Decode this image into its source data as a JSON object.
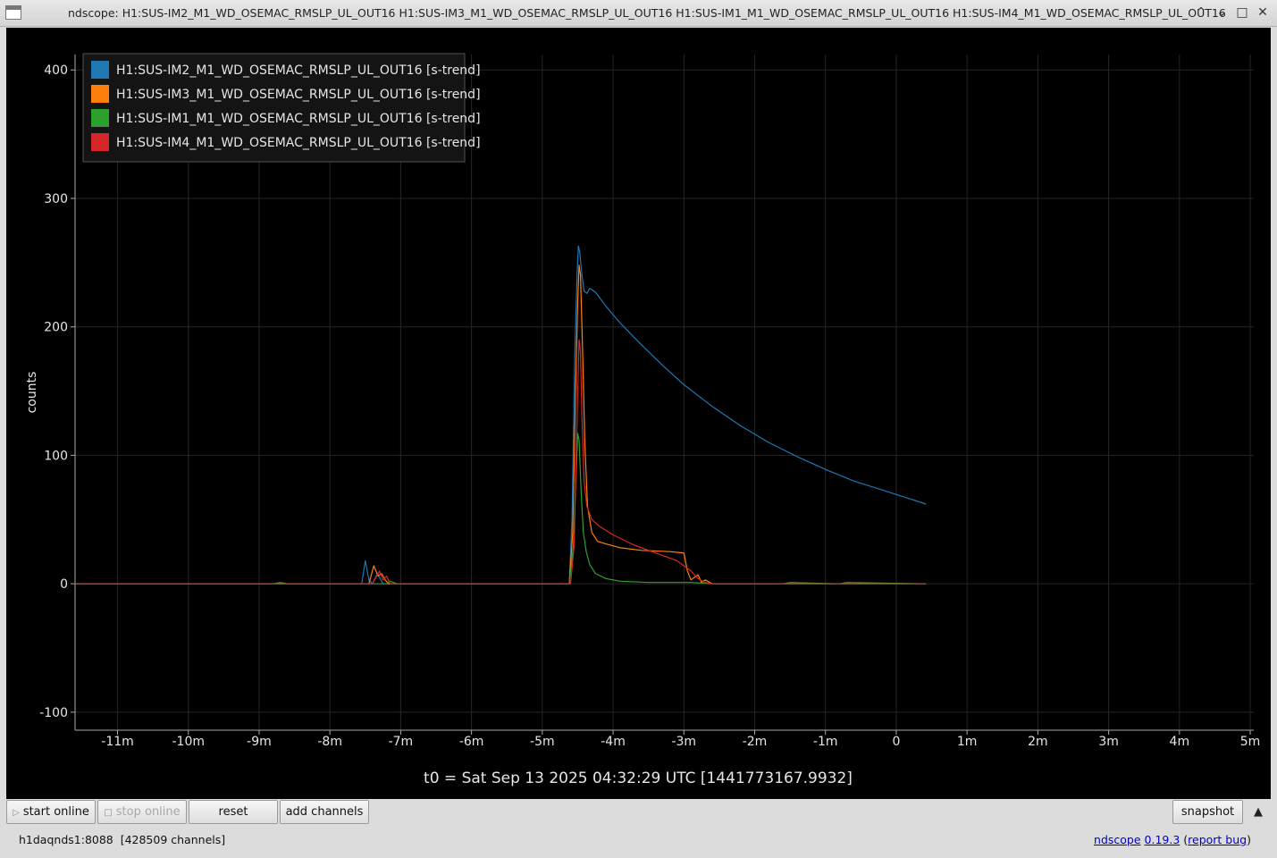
{
  "window": {
    "title": "ndscope: H1:SUS-IM2_M1_WD_OSEMAC_RMSLP_UL_OUT16 H1:SUS-IM3_M1_WD_OSEMAC_RMSLP_UL_OUT16 H1:SUS-IM1_M1_WD_OSEMAC_RMSLP_UL_OUT16 H1:SUS-IM4_M1_WD_OSEMAC_RMSLP_UL_OUT16",
    "minimize_icon": "chevron-up-icon",
    "maximize_icon": "chevron-down-icon",
    "restore_icon": "square-icon",
    "close_icon": "close-icon"
  },
  "chart_data": {
    "type": "line",
    "ylabel": "counts",
    "xlabel": "t0 = Sat Sep 13 2025 04:32:29 UTC [1441773167.9932]",
    "x_units": "minutes",
    "xlim": [
      -11.6,
      5.05
    ],
    "ylim": [
      -114,
      412
    ],
    "x_ticks": [
      -11,
      -10,
      -9,
      -8,
      -7,
      -6,
      -5,
      -4,
      -3,
      -2,
      -1,
      0,
      1,
      2,
      3,
      4,
      5
    ],
    "x_tick_labels": [
      "-11m",
      "-10m",
      "-9m",
      "-8m",
      "-7m",
      "-6m",
      "-5m",
      "-4m",
      "-3m",
      "-2m",
      "-1m",
      "0",
      "1m",
      "2m",
      "3m",
      "4m",
      "5m"
    ],
    "y_ticks": [
      -100,
      0,
      100,
      200,
      300,
      400
    ],
    "y_tick_labels": [
      "-100",
      "0",
      "100",
      "200",
      "300",
      "400"
    ],
    "grid": true,
    "legend_position": "top-left",
    "series": [
      {
        "name": "H1:SUS-IM2_M1_WD_OSEMAC_RMSLP_UL_OUT16 [s-trend]",
        "color": "#1f77b4",
        "x": [
          -11.6,
          -7.55,
          -7.5,
          -7.45,
          -7.4,
          -7.33,
          -7.25,
          -7.2,
          -7.0,
          -4.62,
          -4.58,
          -4.54,
          -4.51,
          -4.49,
          -4.47,
          -4.44,
          -4.41,
          -4.37,
          -4.33,
          -4.25,
          -4.1,
          -3.9,
          -3.6,
          -3.3,
          -3.0,
          -2.6,
          -2.2,
          -1.8,
          -1.4,
          -1.0,
          -0.6,
          -0.2,
          0.2,
          0.42
        ],
        "y": [
          0,
          0,
          18,
          3,
          0,
          8,
          0,
          0,
          0,
          0,
          50,
          180,
          240,
          263,
          258,
          240,
          228,
          226,
          230,
          227,
          216,
          203,
          186,
          170,
          155,
          138,
          123,
          110,
          99,
          89,
          80,
          73,
          66,
          62
        ]
      },
      {
        "name": "H1:SUS-IM3_M1_WD_OSEMAC_RMSLP_UL_OUT16 [s-trend]",
        "color": "#ff7f0e",
        "x": [
          -11.6,
          -7.45,
          -7.38,
          -7.32,
          -7.27,
          -7.22,
          -7.17,
          -7.1,
          -4.62,
          -4.57,
          -4.53,
          -4.5,
          -4.48,
          -4.46,
          -4.43,
          -4.4,
          -4.36,
          -4.3,
          -4.22,
          -4.1,
          -3.9,
          -3.6,
          -3.2,
          -3.0,
          -2.95,
          -2.9,
          -2.8,
          -2.75,
          -2.7,
          -2.6,
          0.42
        ],
        "y": [
          0,
          0,
          14,
          6,
          8,
          3,
          0,
          0,
          0,
          40,
          150,
          220,
          248,
          240,
          180,
          110,
          60,
          40,
          33,
          31,
          28,
          26,
          25,
          24,
          10,
          3,
          7,
          1,
          3,
          0,
          0
        ]
      },
      {
        "name": "H1:SUS-IM1_M1_WD_OSEMAC_RMSLP_UL_OUT16 [s-trend]",
        "color": "#2ca02c",
        "x": [
          -11.6,
          -8.8,
          -8.7,
          -8.6,
          -7.2,
          -7.15,
          -7.05,
          -4.62,
          -4.56,
          -4.52,
          -4.5,
          -4.48,
          -4.45,
          -4.42,
          -4.38,
          -4.33,
          -4.25,
          -4.1,
          -3.9,
          -3.5,
          -2.9,
          -2.6,
          -1.6,
          -1.5,
          -0.8,
          -0.7,
          0.42
        ],
        "y": [
          0,
          0,
          1,
          0,
          0,
          2,
          0,
          0,
          30,
          90,
          117,
          112,
          70,
          40,
          25,
          15,
          8,
          4,
          2,
          1,
          1,
          0,
          0,
          1,
          0,
          1,
          0
        ]
      },
      {
        "name": "H1:SUS-IM4_M1_WD_OSEMAC_RMSLP_UL_OUT16 [s-trend]",
        "color": "#d62728",
        "x": [
          -11.6,
          -7.4,
          -7.3,
          -7.25,
          -7.2,
          -7.15,
          -4.6,
          -4.55,
          -4.5,
          -4.48,
          -4.46,
          -4.44,
          -4.41,
          -4.37,
          -4.3,
          -4.2,
          -4.0,
          -3.7,
          -3.4,
          -3.1,
          -2.9,
          -2.8,
          -2.7,
          -2.6,
          0.42
        ],
        "y": [
          0,
          0,
          10,
          3,
          6,
          0,
          0,
          30,
          150,
          190,
          180,
          130,
          80,
          60,
          50,
          45,
          38,
          30,
          24,
          18,
          10,
          4,
          1,
          0,
          0
        ]
      }
    ]
  },
  "toolbar": {
    "start_online_label": "start online",
    "stop_online_label": "stop online",
    "reset_label": "reset",
    "add_channels_label": "add channels",
    "snapshot_label": "snapshot",
    "expand_icon": "triangle-up-icon"
  },
  "status": {
    "server": "h1daqnds1:8088  [428509 channels]",
    "app_name": "ndscope",
    "version": "0.19.3",
    "report_bug": "report bug",
    "paren_open": "(",
    "paren_close": ")"
  }
}
